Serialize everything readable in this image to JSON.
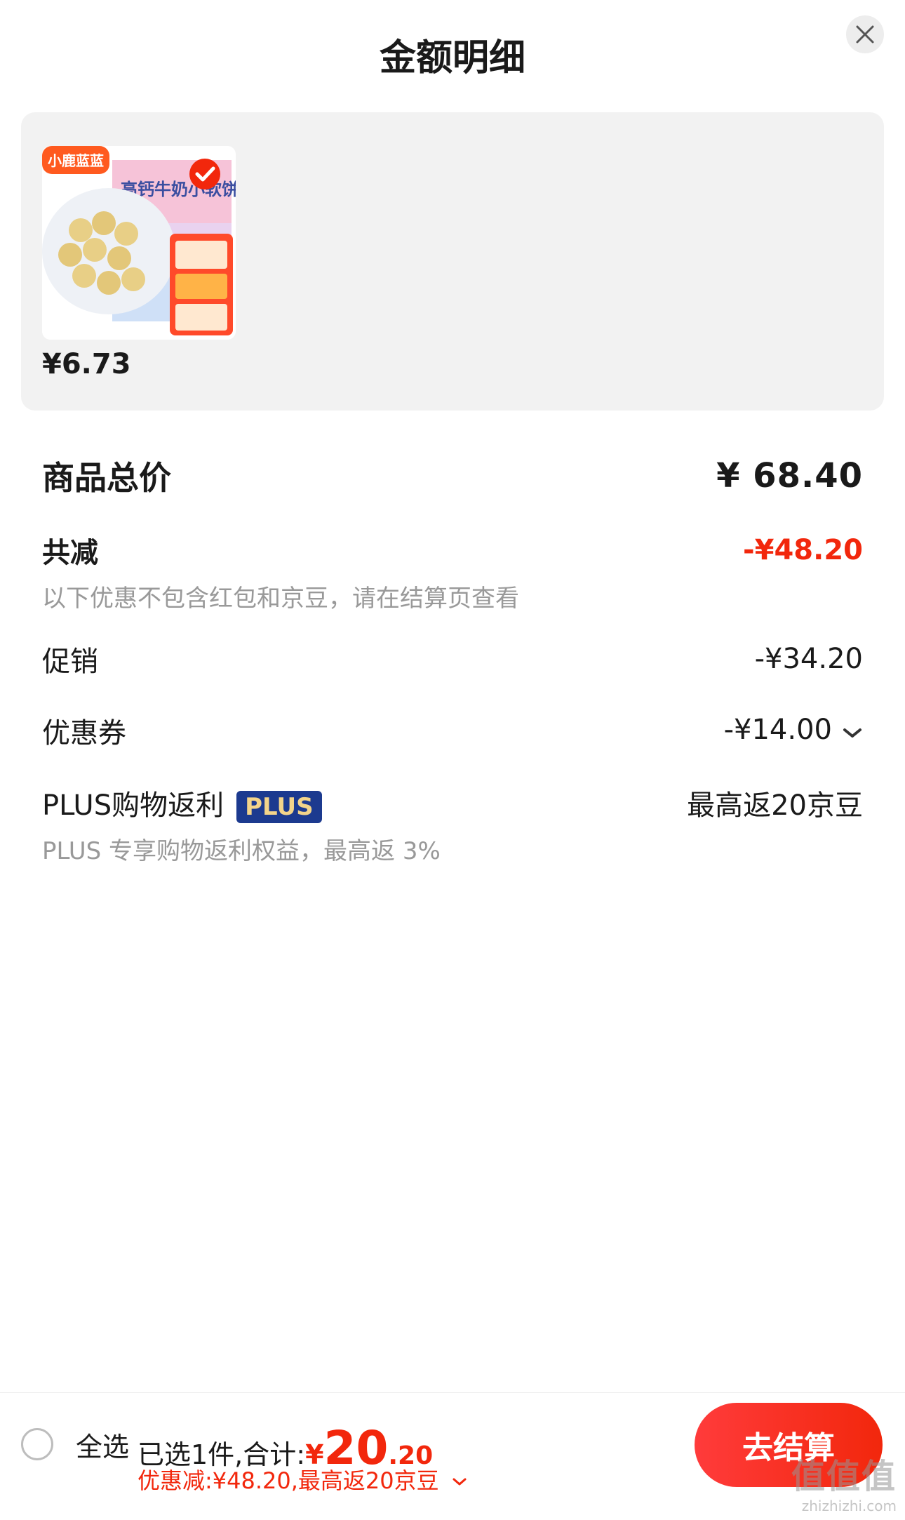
{
  "header": {
    "title": "金额明细"
  },
  "product": {
    "price": "¥6.73",
    "brand_badge": "小鹿蓝蓝",
    "box_text": "高钙牛奶小软饼"
  },
  "summary": {
    "total_label": "商品总价",
    "total_value": "¥ 68.40",
    "reduce_label": "共减",
    "reduce_value": "-¥48.20",
    "reduce_note": "以下优惠不包含红包和京豆，请在结算页查看",
    "promo_label": "促销",
    "promo_value": "-¥34.20",
    "coupon_label": "优惠券",
    "coupon_value": "-¥14.00",
    "plus_label": "PLUS购物返利",
    "plus_badge": "PLUS",
    "plus_value": "最高返20京豆",
    "plus_note": "PLUS 专享购物返利权益，最高返 3%"
  },
  "footer": {
    "select_all": "全选",
    "selected_text": "已选1件,合计:",
    "currency": "¥",
    "price_int": "20",
    "price_dec": ".20",
    "discount_text": "优惠减:¥48.20,最高返20京豆",
    "checkout_label": "去结算",
    "watermark": "值值值",
    "watermark_url": "zhizhizhi.com"
  },
  "colors": {
    "accent_red": "#f2270c",
    "plus_badge_bg": "#1c3a8f",
    "panel_bg": "#f2f2f2"
  }
}
